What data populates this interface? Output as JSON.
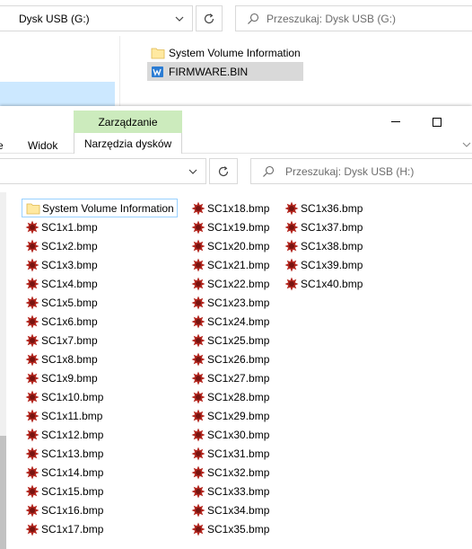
{
  "back_window": {
    "address": "Dysk USB (G:)",
    "search_placeholder": "Przeszukaj: Dysk USB (G:)",
    "items": [
      {
        "label": "System Volume Information",
        "icon": "folder-icon"
      },
      {
        "label": "FIRMWARE.BIN",
        "icon": "bin-file-icon"
      }
    ]
  },
  "front_window": {
    "ribbon": {
      "tab_partial": "e",
      "view_tab": "Widok",
      "manage_group": "Zarządzanie",
      "drive_tools_tab": "Narzędzia dysków"
    },
    "search_placeholder": "Przeszukaj: Dysk USB (H:)",
    "folder": {
      "label": "System Volume Information",
      "icon": "folder-icon"
    },
    "files": [
      "SC1x1.bmp",
      "SC1x2.bmp",
      "SC1x3.bmp",
      "SC1x4.bmp",
      "SC1x5.bmp",
      "SC1x6.bmp",
      "SC1x7.bmp",
      "SC1x8.bmp",
      "SC1x9.bmp",
      "SC1x10.bmp",
      "SC1x11.bmp",
      "SC1x12.bmp",
      "SC1x13.bmp",
      "SC1x14.bmp",
      "SC1x15.bmp",
      "SC1x16.bmp",
      "SC1x17.bmp",
      "SC1x18.bmp",
      "SC1x19.bmp",
      "SC1x20.bmp",
      "SC1x21.bmp",
      "SC1x22.bmp",
      "SC1x23.bmp",
      "SC1x24.bmp",
      "SC1x25.bmp",
      "SC1x26.bmp",
      "SC1x27.bmp",
      "SC1x28.bmp",
      "SC1x29.bmp",
      "SC1x30.bmp",
      "SC1x31.bmp",
      "SC1x32.bmp",
      "SC1x33.bmp",
      "SC1x34.bmp",
      "SC1x35.bmp",
      "SC1x36.bmp",
      "SC1x37.bmp",
      "SC1x38.bmp",
      "SC1x39.bmp",
      "SC1x40.bmp"
    ],
    "file_icon": "bmp-image-icon"
  },
  "colors": {
    "manage_group_bg": "#ccebbd",
    "selection_bg": "#cce8ff",
    "focus_border": "#99d1ff",
    "bmp_icon": "#b3261e"
  }
}
